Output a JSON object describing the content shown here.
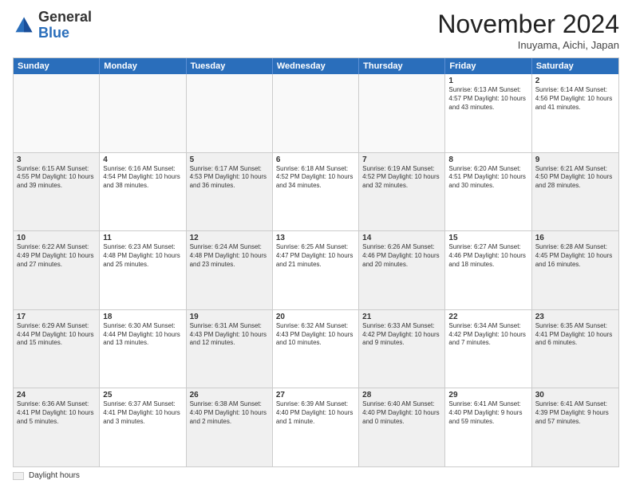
{
  "logo": {
    "general": "General",
    "blue": "Blue"
  },
  "title": "November 2024",
  "location": "Inuyama, Aichi, Japan",
  "days_of_week": [
    "Sunday",
    "Monday",
    "Tuesday",
    "Wednesday",
    "Thursday",
    "Friday",
    "Saturday"
  ],
  "legend": {
    "label": "Daylight hours"
  },
  "weeks": [
    [
      {
        "day": "",
        "info": "",
        "empty": true
      },
      {
        "day": "",
        "info": "",
        "empty": true
      },
      {
        "day": "",
        "info": "",
        "empty": true
      },
      {
        "day": "",
        "info": "",
        "empty": true
      },
      {
        "day": "",
        "info": "",
        "empty": true
      },
      {
        "day": "1",
        "info": "Sunrise: 6:13 AM\nSunset: 4:57 PM\nDaylight: 10 hours\nand 43 minutes."
      },
      {
        "day": "2",
        "info": "Sunrise: 6:14 AM\nSunset: 4:56 PM\nDaylight: 10 hours\nand 41 minutes."
      }
    ],
    [
      {
        "day": "3",
        "info": "Sunrise: 6:15 AM\nSunset: 4:55 PM\nDaylight: 10 hours\nand 39 minutes.",
        "shaded": true
      },
      {
        "day": "4",
        "info": "Sunrise: 6:16 AM\nSunset: 4:54 PM\nDaylight: 10 hours\nand 38 minutes."
      },
      {
        "day": "5",
        "info": "Sunrise: 6:17 AM\nSunset: 4:53 PM\nDaylight: 10 hours\nand 36 minutes.",
        "shaded": true
      },
      {
        "day": "6",
        "info": "Sunrise: 6:18 AM\nSunset: 4:52 PM\nDaylight: 10 hours\nand 34 minutes."
      },
      {
        "day": "7",
        "info": "Sunrise: 6:19 AM\nSunset: 4:52 PM\nDaylight: 10 hours\nand 32 minutes.",
        "shaded": true
      },
      {
        "day": "8",
        "info": "Sunrise: 6:20 AM\nSunset: 4:51 PM\nDaylight: 10 hours\nand 30 minutes."
      },
      {
        "day": "9",
        "info": "Sunrise: 6:21 AM\nSunset: 4:50 PM\nDaylight: 10 hours\nand 28 minutes.",
        "shaded": true
      }
    ],
    [
      {
        "day": "10",
        "info": "Sunrise: 6:22 AM\nSunset: 4:49 PM\nDaylight: 10 hours\nand 27 minutes.",
        "shaded": true
      },
      {
        "day": "11",
        "info": "Sunrise: 6:23 AM\nSunset: 4:48 PM\nDaylight: 10 hours\nand 25 minutes."
      },
      {
        "day": "12",
        "info": "Sunrise: 6:24 AM\nSunset: 4:48 PM\nDaylight: 10 hours\nand 23 minutes.",
        "shaded": true
      },
      {
        "day": "13",
        "info": "Sunrise: 6:25 AM\nSunset: 4:47 PM\nDaylight: 10 hours\nand 21 minutes."
      },
      {
        "day": "14",
        "info": "Sunrise: 6:26 AM\nSunset: 4:46 PM\nDaylight: 10 hours\nand 20 minutes.",
        "shaded": true
      },
      {
        "day": "15",
        "info": "Sunrise: 6:27 AM\nSunset: 4:46 PM\nDaylight: 10 hours\nand 18 minutes."
      },
      {
        "day": "16",
        "info": "Sunrise: 6:28 AM\nSunset: 4:45 PM\nDaylight: 10 hours\nand 16 minutes.",
        "shaded": true
      }
    ],
    [
      {
        "day": "17",
        "info": "Sunrise: 6:29 AM\nSunset: 4:44 PM\nDaylight: 10 hours\nand 15 minutes.",
        "shaded": true
      },
      {
        "day": "18",
        "info": "Sunrise: 6:30 AM\nSunset: 4:44 PM\nDaylight: 10 hours\nand 13 minutes."
      },
      {
        "day": "19",
        "info": "Sunrise: 6:31 AM\nSunset: 4:43 PM\nDaylight: 10 hours\nand 12 minutes.",
        "shaded": true
      },
      {
        "day": "20",
        "info": "Sunrise: 6:32 AM\nSunset: 4:43 PM\nDaylight: 10 hours\nand 10 minutes."
      },
      {
        "day": "21",
        "info": "Sunrise: 6:33 AM\nSunset: 4:42 PM\nDaylight: 10 hours\nand 9 minutes.",
        "shaded": true
      },
      {
        "day": "22",
        "info": "Sunrise: 6:34 AM\nSunset: 4:42 PM\nDaylight: 10 hours\nand 7 minutes."
      },
      {
        "day": "23",
        "info": "Sunrise: 6:35 AM\nSunset: 4:41 PM\nDaylight: 10 hours\nand 6 minutes.",
        "shaded": true
      }
    ],
    [
      {
        "day": "24",
        "info": "Sunrise: 6:36 AM\nSunset: 4:41 PM\nDaylight: 10 hours\nand 5 minutes.",
        "shaded": true
      },
      {
        "day": "25",
        "info": "Sunrise: 6:37 AM\nSunset: 4:41 PM\nDaylight: 10 hours\nand 3 minutes."
      },
      {
        "day": "26",
        "info": "Sunrise: 6:38 AM\nSunset: 4:40 PM\nDaylight: 10 hours\nand 2 minutes.",
        "shaded": true
      },
      {
        "day": "27",
        "info": "Sunrise: 6:39 AM\nSunset: 4:40 PM\nDaylight: 10 hours\nand 1 minute."
      },
      {
        "day": "28",
        "info": "Sunrise: 6:40 AM\nSunset: 4:40 PM\nDaylight: 10 hours\nand 0 minutes.",
        "shaded": true
      },
      {
        "day": "29",
        "info": "Sunrise: 6:41 AM\nSunset: 4:40 PM\nDaylight: 9 hours\nand 59 minutes."
      },
      {
        "day": "30",
        "info": "Sunrise: 6:41 AM\nSunset: 4:39 PM\nDaylight: 9 hours\nand 57 minutes.",
        "shaded": true
      }
    ]
  ]
}
